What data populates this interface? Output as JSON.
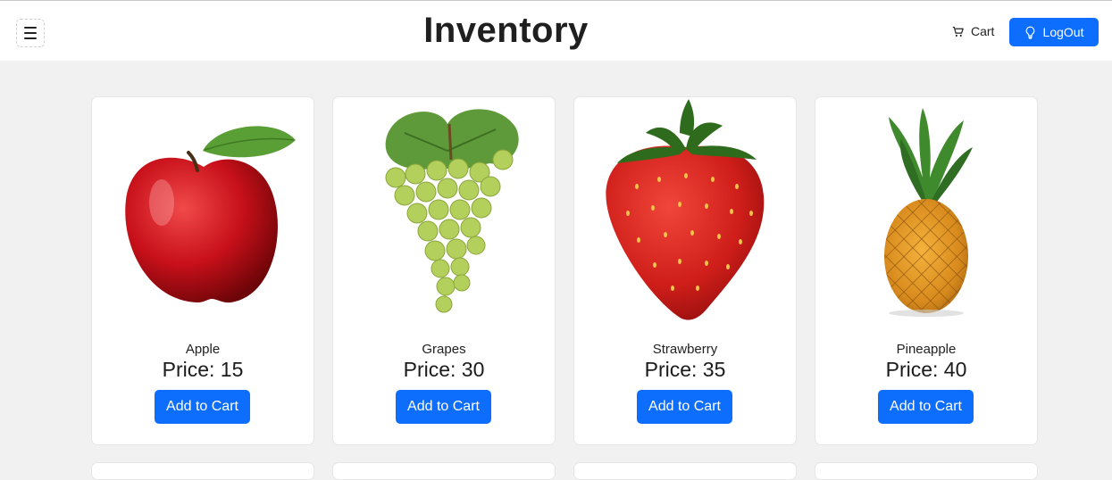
{
  "header": {
    "title": "Inventory",
    "cart_label": "Cart",
    "logout_label": "LogOut",
    "accent": "#0d6efd"
  },
  "products": [
    {
      "name": "Apple",
      "price": "Price: 15",
      "button": "Add to Cart",
      "image": "apple"
    },
    {
      "name": "Grapes",
      "price": "Price: 30",
      "button": "Add to Cart",
      "image": "grapes"
    },
    {
      "name": "Strawberry",
      "price": "Price: 35",
      "button": "Add to Cart",
      "image": "strawberry"
    },
    {
      "name": "Pineapple",
      "price": "Price: 40",
      "button": "Add to Cart",
      "image": "pineapple"
    }
  ]
}
